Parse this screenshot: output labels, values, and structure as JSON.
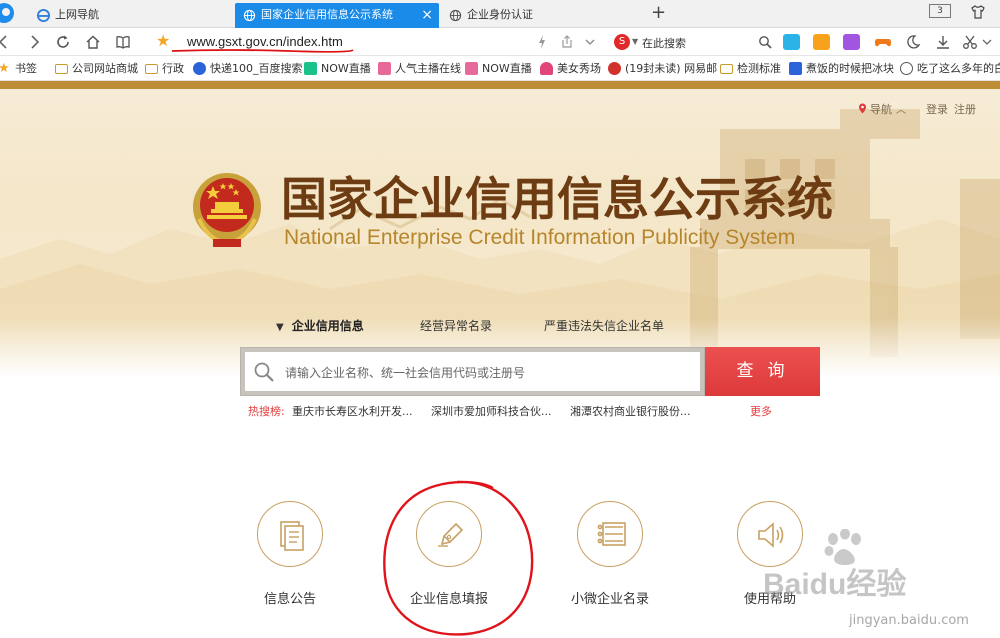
{
  "browser": {
    "tabs": [
      {
        "label": "上网导航",
        "active": false
      },
      {
        "label": "国家企业信用信息公示系统",
        "active": true
      },
      {
        "label": "企业身份认证",
        "active": false
      }
    ],
    "tab_close": "×",
    "new_tab": "+",
    "tab_count": "3",
    "address": {
      "url": "www.gsxt.gov.cn/index.htm"
    },
    "search": {
      "engine_glyph": "S",
      "placeholder": "在此搜索"
    },
    "bookmarks": [
      {
        "label": "书签",
        "icon": "star-icon",
        "color": "#f5a623"
      },
      {
        "label": "公司网站商城",
        "icon": "folder-icon",
        "color": "#c89b2a"
      },
      {
        "label": "行政",
        "icon": "folder-icon",
        "color": "#c89b2a"
      },
      {
        "label": "快递100_百度搜索",
        "icon": "paw-icon",
        "color": "#2b63d9"
      },
      {
        "label": "NOW直播",
        "icon": "now-icon",
        "color": "#19c28a"
      },
      {
        "label": "人气主播在线",
        "icon": "avatar-icon",
        "color": "#e86a9a"
      },
      {
        "label": "NOW直播",
        "icon": "avatar-icon",
        "color": "#e86a9a"
      },
      {
        "label": "美女秀场",
        "icon": "headphone-icon",
        "color": "#e0457b"
      },
      {
        "label": "(19封未读) 网易邮",
        "icon": "mail-icon",
        "color": "#d0312d"
      },
      {
        "label": "检测标准",
        "icon": "folder-icon",
        "color": "#c89b2a"
      },
      {
        "label": "煮饭的时候把冰块",
        "icon": "baidu-icon",
        "color": "#2b63d9"
      },
      {
        "label": "吃了这么多年的白",
        "icon": "globe-icon",
        "color": "#555555"
      }
    ]
  },
  "site": {
    "top_links": {
      "nav": "导航",
      "login": "登录",
      "register": "注册"
    },
    "title_cn": "国家企业信用信息公示系统",
    "title_en": "National Enterprise Credit Information Publicity System",
    "search_tabs": [
      {
        "label": "企业信用信息",
        "active": true
      },
      {
        "label": "经营异常名录",
        "active": false
      },
      {
        "label": "严重违法失信企业名单",
        "active": false
      }
    ],
    "search": {
      "placeholder": "请输入企业名称、统一社会信用代码或注册号",
      "button": "查询"
    },
    "hot": {
      "label": "热搜榜:",
      "items": [
        "重庆市长寿区水利开发...",
        "深圳市爱加师科技合伙...",
        "湘潭农村商业银行股份..."
      ],
      "more": "更多"
    },
    "features": [
      {
        "label": "信息公告",
        "icon": "document-icon"
      },
      {
        "label": "企业信息填报",
        "icon": "pen-nib-icon"
      },
      {
        "label": "小微企业名录",
        "icon": "list-icon"
      },
      {
        "label": "使用帮助",
        "icon": "speaker-icon"
      }
    ],
    "accent_gold": "#bd8e35",
    "title_brown": "#6e3c13",
    "search_red": "#e04444"
  },
  "watermark": {
    "brand": "Baidu经验",
    "url": "jingyan.baidu.com"
  }
}
